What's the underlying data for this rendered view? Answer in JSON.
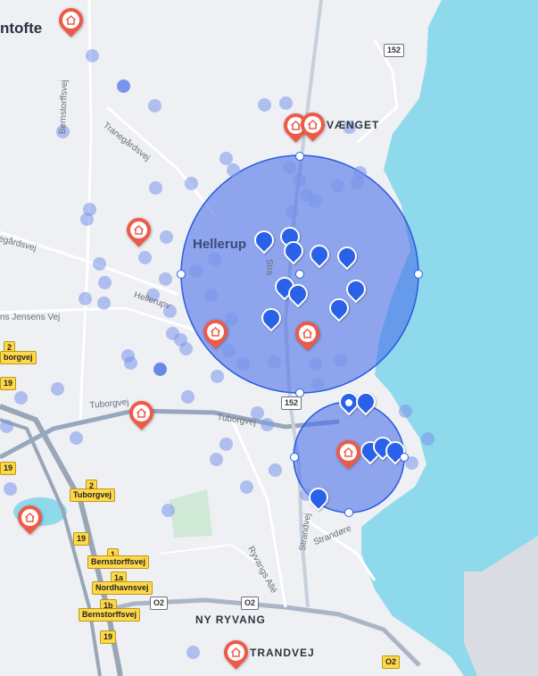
{
  "map": {
    "colors": {
      "water": "#8fd9ec",
      "land": "#eef0f3",
      "radius_fill": "#5a7de8",
      "radius_stroke": "#2a5be0",
      "pin": "#2962e8",
      "home": "#ee5a48"
    },
    "places": {
      "gentofte": "ntofte",
      "ny_ryvang": "NY RYVANG",
      "strandvej_area": "TRANDVEJ",
      "vaenget": "VÆNGET",
      "hellerup": "Hellerup"
    },
    "streets": {
      "bernstorffsvej": "Bernstorffsvej",
      "tranegaardsvej": "Tranegårdsvej",
      "hegaardsvej": "egårdsvej",
      "hellerupvej": "Hellerupv",
      "jensens_vej": "ns Jensens Vej",
      "tuborgvej_west": "Tuborgvej",
      "tuborgvej_east": "Tuborgvej",
      "strandvej": "Strandvej",
      "strandvej_north": "Stra",
      "strandore": "Strandøre",
      "ryvangs_alle": "Ryvangs Allé"
    },
    "route_shields": {
      "r152_top": "152",
      "r152_mid": "152",
      "r02_left": "O2",
      "r02_mid": "O2",
      "r02_right": "O2",
      "r19_a": "19",
      "r19_b": "19",
      "r19_c": "19",
      "r19_d": "19",
      "r2_a": "2",
      "r2_b": "2",
      "borgvej": "borgvej",
      "tuborgvej_box": "Tuborgvej",
      "bernstorffsvej_a": "Bernstorffsvej",
      "bernstorffsvej_b": "Bernstorffsvej",
      "n1": "1",
      "n1a": "1a",
      "n1b": "1b",
      "nordhavnsvej": "Nordhavnsvej"
    }
  }
}
